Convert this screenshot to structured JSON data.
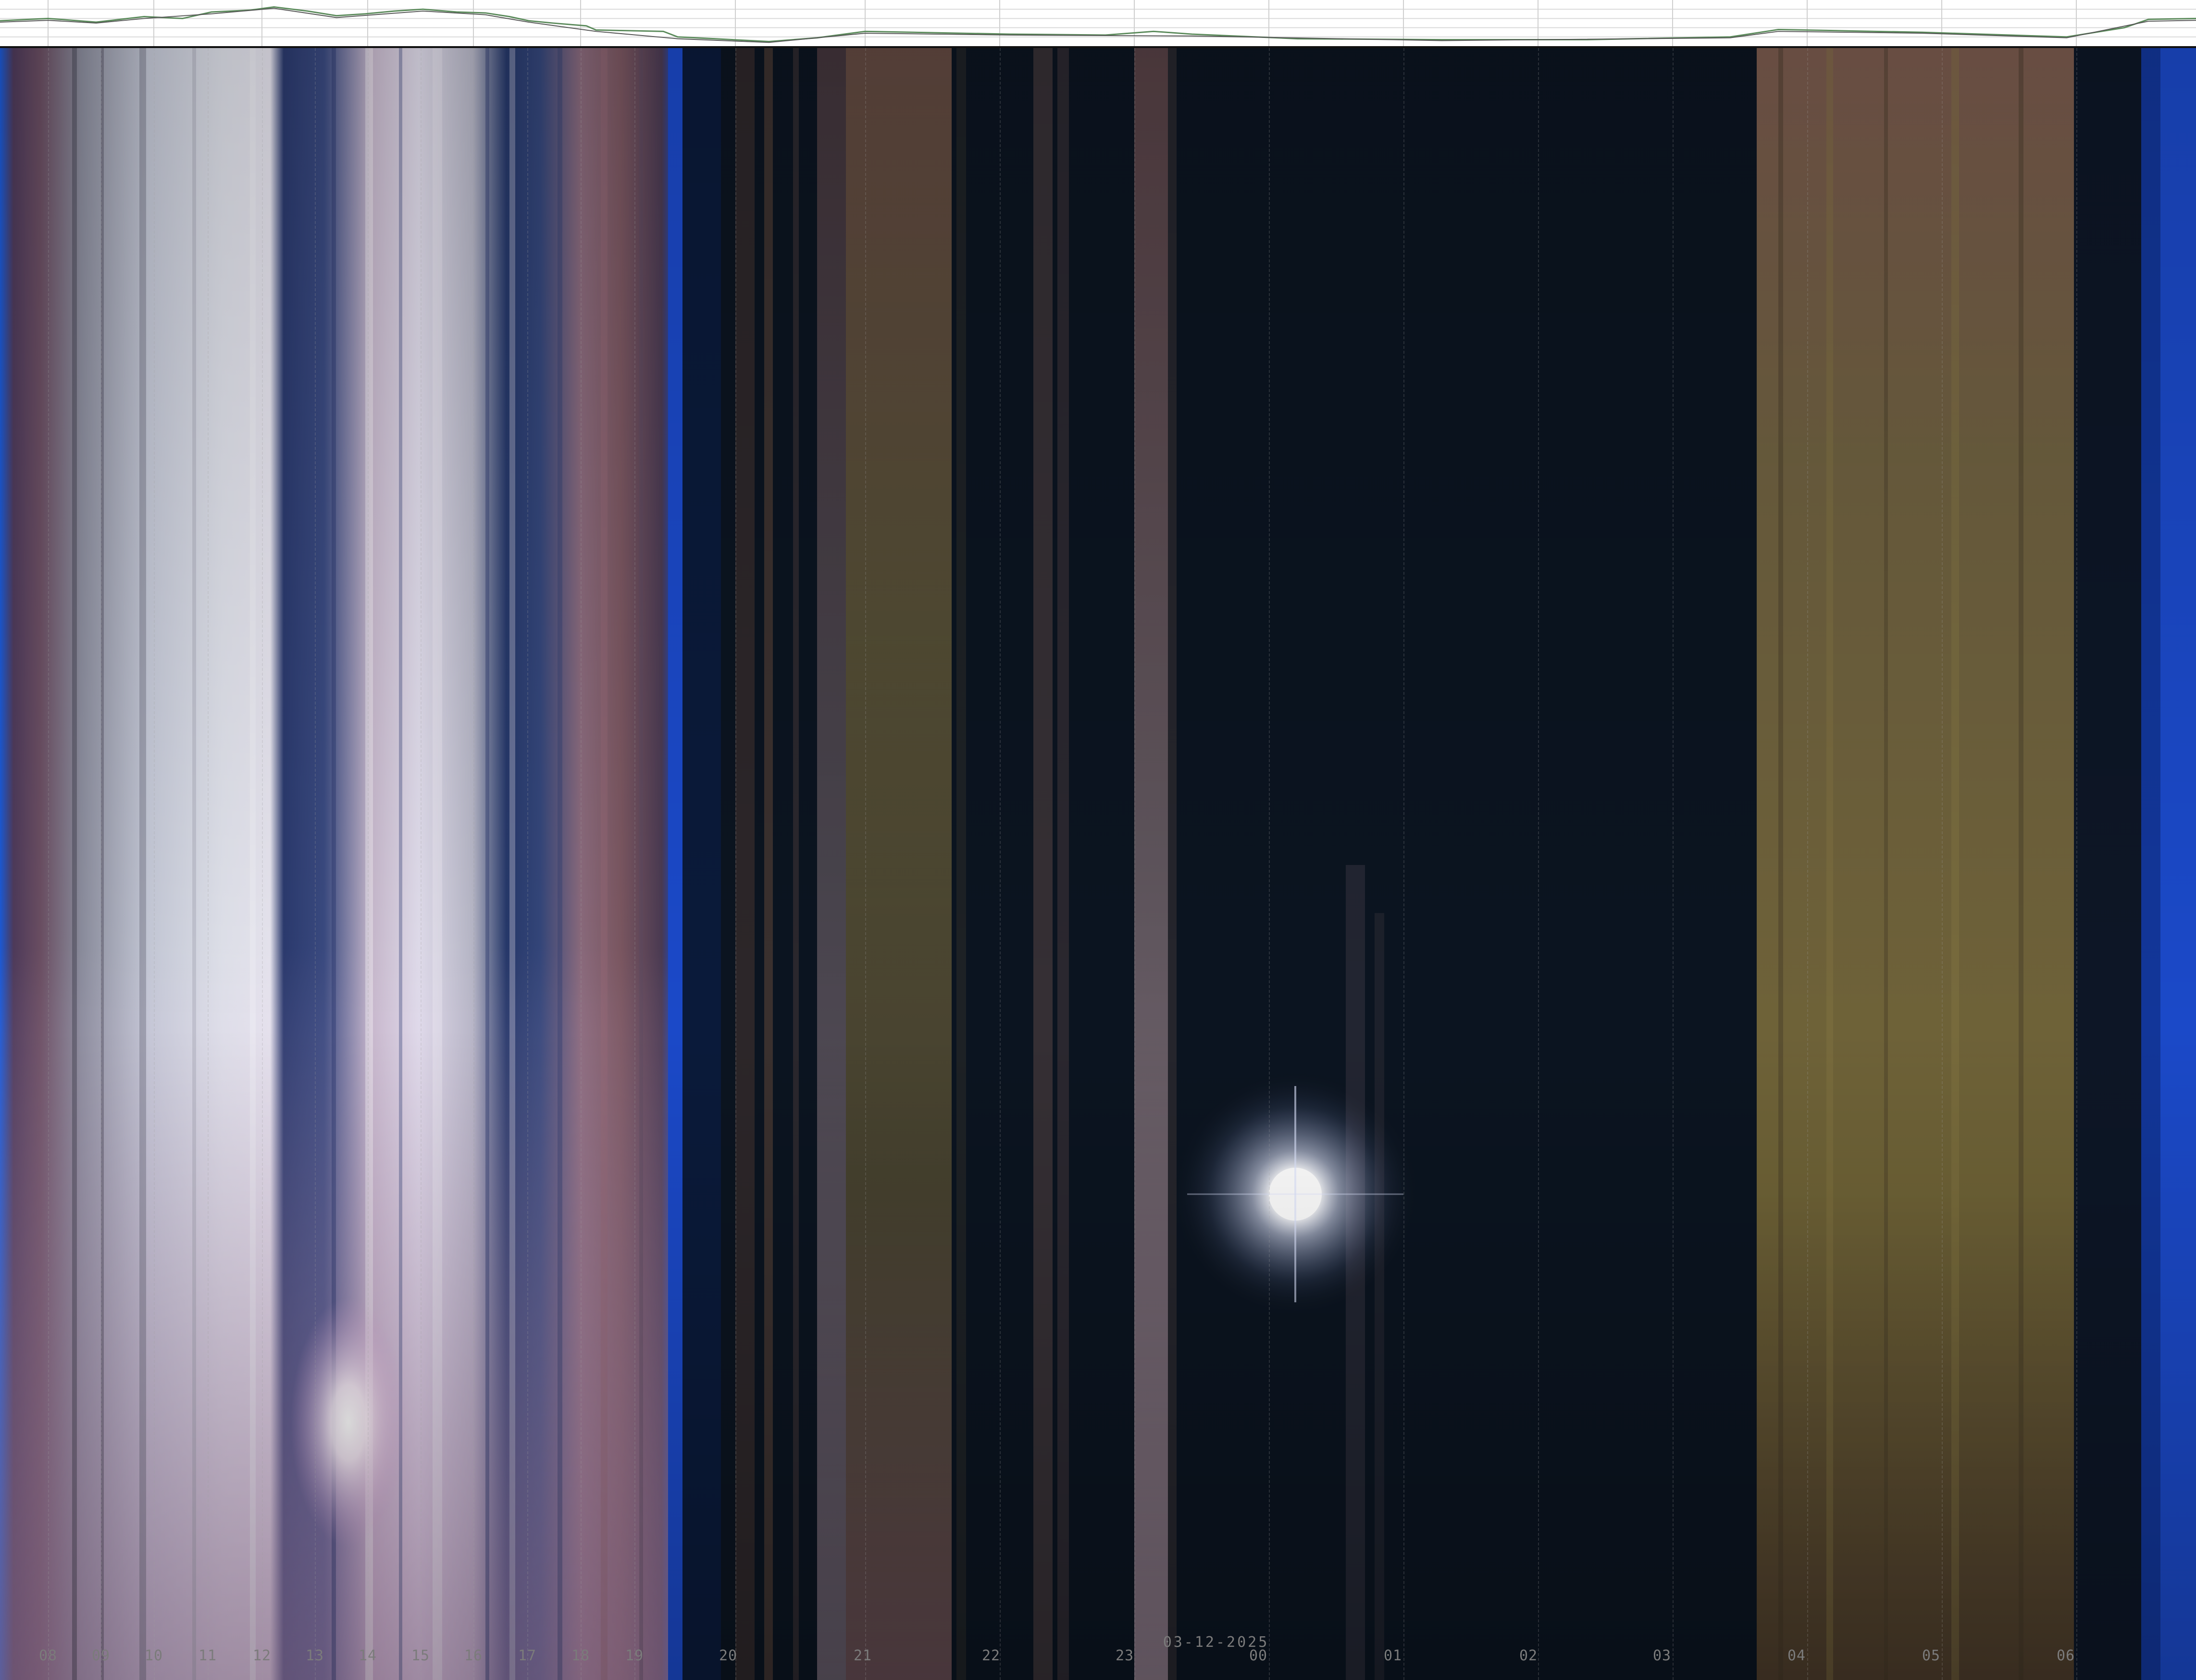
{
  "timeline": {
    "date_label": "03-12-2025",
    "hours": [
      "08",
      "09",
      "10",
      "11",
      "12",
      "13",
      "14",
      "15",
      "16",
      "17",
      "18",
      "19",
      "20",
      "21",
      "22",
      "23",
      "00",
      "01",
      "02",
      "03",
      "04",
      "05",
      "06"
    ]
  },
  "colors": {
    "twilight_blue": "#1a4fd0",
    "night_sky": "#0b1420",
    "moon_glow": "#ffffff",
    "olive_band": "#6e6236",
    "dusk_pink": "#8c6a72",
    "daylight_white": "#d9dbe6",
    "label_gray": "#7b7b7b"
  }
}
